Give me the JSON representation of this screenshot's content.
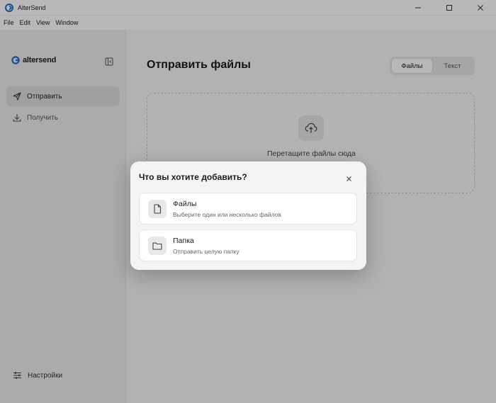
{
  "window": {
    "title": "AlterSend",
    "minimize_icon": "minimize-icon",
    "maximize_icon": "maximize-icon",
    "close_icon": "close-icon"
  },
  "menu": {
    "items": [
      "File",
      "Edit",
      "View",
      "Window"
    ]
  },
  "sidebar": {
    "logo_text": "altersend",
    "items": [
      {
        "label": "Отправить",
        "icon": "send-icon",
        "active": true
      },
      {
        "label": "Получить",
        "icon": "download-icon",
        "active": false
      }
    ],
    "settings_label": "Настройки"
  },
  "main": {
    "title": "Отправить файлы",
    "tabs": [
      {
        "label": "Файлы",
        "active": true
      },
      {
        "label": "Текст",
        "active": false
      }
    ],
    "dropzone_text": "Перетащите файлы сюда"
  },
  "modal": {
    "title": "Что вы хотите добавить?",
    "options": [
      {
        "title": "Файлы",
        "subtitle": "Выберите один или несколько файлов",
        "icon": "file-icon"
      },
      {
        "title": "Папка",
        "subtitle": "Отправить целую папку",
        "icon": "folder-icon"
      }
    ]
  },
  "colors": {
    "accent": "#1e6fd9",
    "overlay": "rgba(0,0,0,0.28)"
  }
}
